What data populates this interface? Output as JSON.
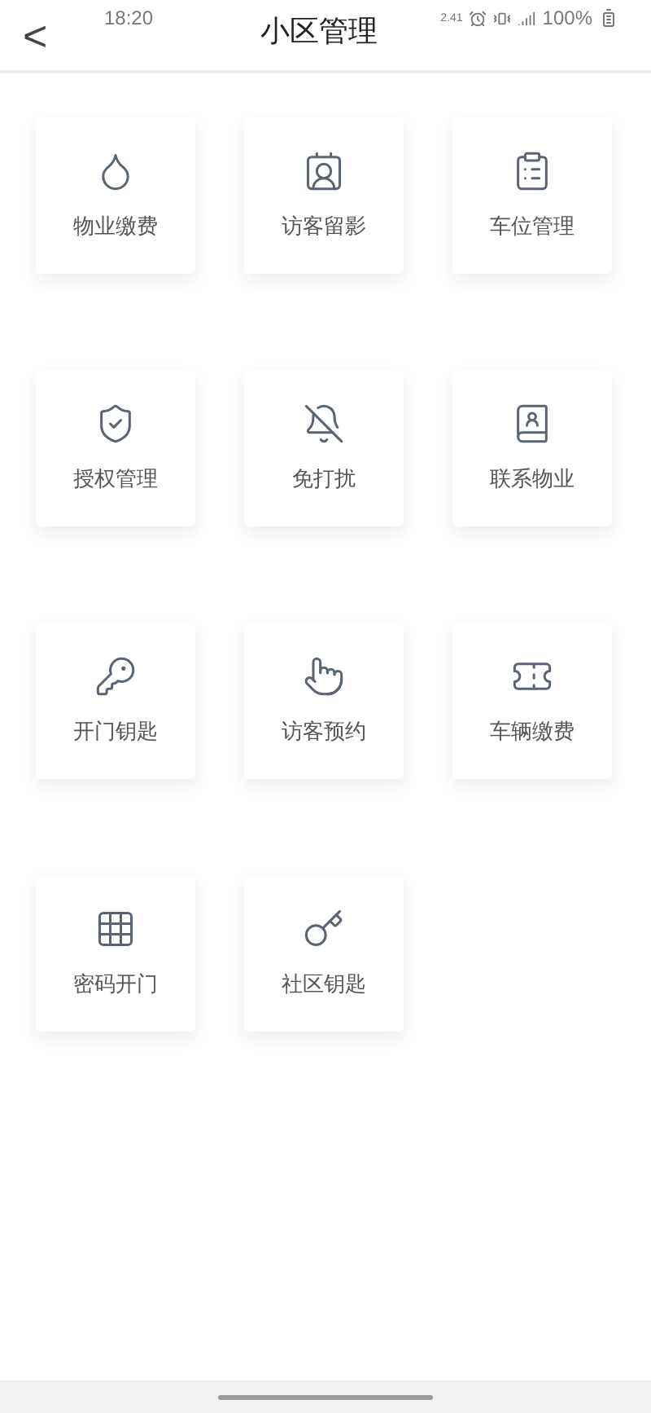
{
  "status_bar": {
    "time": "18:20",
    "speed": "2.41",
    "battery": "100%"
  },
  "header": {
    "back": "<",
    "title": "小区管理"
  },
  "tiles": [
    {
      "label": "物业缴费"
    },
    {
      "label": "访客留影"
    },
    {
      "label": "车位管理"
    },
    {
      "label": "授权管理"
    },
    {
      "label": "免打扰"
    },
    {
      "label": "联系物业"
    },
    {
      "label": "开门钥匙"
    },
    {
      "label": "访客预约"
    },
    {
      "label": "车辆缴费"
    },
    {
      "label": "密码开门"
    },
    {
      "label": "社区钥匙"
    }
  ]
}
